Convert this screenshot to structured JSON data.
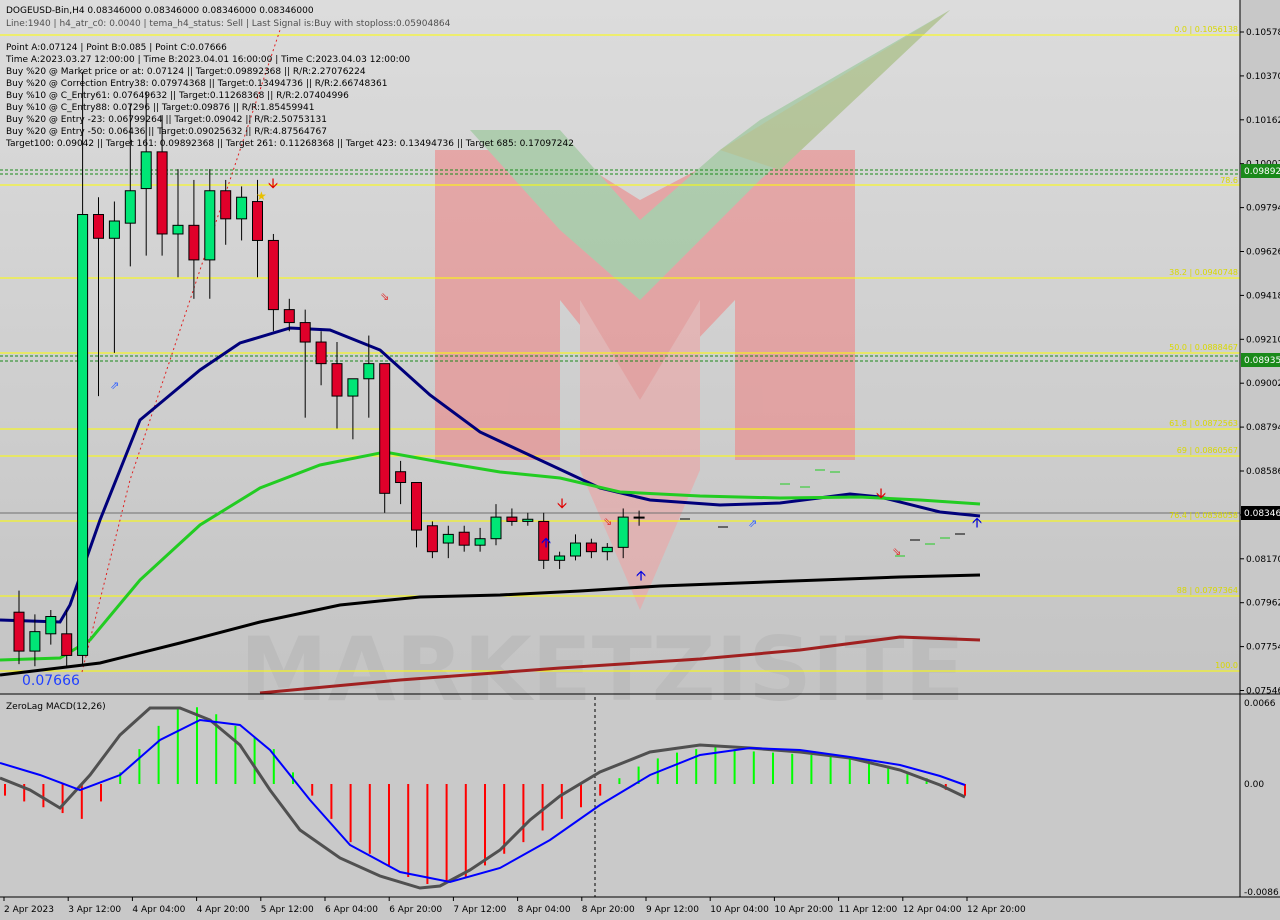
{
  "colors": {
    "background": "#c8c8c8",
    "bull_candle": "#00e676",
    "bear_candle": "#e0002a",
    "ma_navy": "#00007a",
    "ma_green": "#22cc22",
    "ma_black": "#000000",
    "ma_maroon": "#a02020",
    "fib_line": "#ffff00",
    "histogram_up": "#00ff00",
    "histogram_down": "#ff0000",
    "macd_line": "#505050",
    "signal_line": "#0000ff"
  },
  "header": {
    "symbol_line": "DOGEUSD-Bin,H4  0.08346000 0.08346000 0.08346000 0.08346000",
    "overlay_line": "Line:1940 | h4_atr_c0: 0.0040 | tema_h4_status: Sell | Last Signal is:Buy with stoploss:0.05904864",
    "lines": [
      "Point A:0.07124 | Point B:0.085 | Point C:0.07666",
      "Time A:2023.03.27 12:00:00 | Time B:2023.04.01 16:00:00 | Time C:2023.04.03 12:00:00",
      "Buy %20 @ Market price or at: 0.07124 || Target:0.09892368 || R/R:2.27076224",
      "Buy %20 @ Correction Entry38: 0.07974368 || Target:0.13494736 || R/R:2.66748361",
      "Buy %10 @ C_Entry61: 0.07649632 || Target:0.11268368 || R/R:2.07404996",
      "Buy %10 @ C_Entry88: 0.07296 || Target:0.09876 || R/R:1.85459941",
      "Buy %20 @ Entry -23: 0.06799264 || Target:0.09042 || R/R:2.50753131",
      "Buy %20 @ Entry -50: 0.06436 || Target:0.09025632 || R/R:4.87564767",
      "Target100: 0.09042 || Target 161: 0.09892368 || Target 261: 0.11268368 || Target 423: 0.13494736 || Target 685: 0.17097242"
    ]
  },
  "price_axis": {
    "ticks": [
      "0.10578",
      "0.10370",
      "0.10162",
      "0.10001",
      "0.09794",
      "0.09626",
      "0.09418",
      "0.09210",
      "0.09002",
      "0.08794",
      "0.08586",
      "0.08346",
      "0.08170",
      "0.07962",
      "0.07754",
      "0.07546"
    ],
    "current_price": "0.08346",
    "green_boxes": [
      "0.09892",
      "0.08935"
    ]
  },
  "fib_labels": [
    "0.0 | 0.1056138",
    "78.6",
    "38.2 | 0.0940748",
    "50.0 | 0.0888467",
    "61.8 | 0.0872563",
    "69 | 0.0860567",
    "76.4 | 0.0838058",
    "88 | 0.0797364",
    "100.0"
  ],
  "point_c_label": "0.07666",
  "watermark": "MARKETZISITE",
  "macd": {
    "title": "ZeroLag MACD(12,26)",
    "ticks": [
      "0.0066",
      "0.00",
      "-0.0086"
    ]
  },
  "time_axis": [
    "2 Apr 2023",
    "3 Apr 12:00",
    "4 Apr 04:00",
    "4 Apr 20:00",
    "5 Apr 12:00",
    "6 Apr 04:00",
    "6 Apr 20:00",
    "7 Apr 12:00",
    "8 Apr 04:00",
    "8 Apr 20:00",
    "9 Apr 12:00",
    "10 Apr 04:00",
    "10 Apr 20:00",
    "11 Apr 12:00",
    "12 Apr 04:00",
    "12 Apr 20:00"
  ],
  "chart_data": {
    "type": "candlestick",
    "title": "DOGEUSD-Bin,H4",
    "ylim": [
      0.0754,
      0.1064
    ],
    "candles": [
      {
        "o": 0.079,
        "h": 0.08,
        "l": 0.0766,
        "c": 0.0772
      },
      {
        "o": 0.0772,
        "h": 0.0789,
        "l": 0.0765,
        "c": 0.0781
      },
      {
        "o": 0.078,
        "h": 0.0791,
        "l": 0.0775,
        "c": 0.0788
      },
      {
        "o": 0.078,
        "h": 0.0791,
        "l": 0.0765,
        "c": 0.077
      },
      {
        "o": 0.077,
        "h": 0.104,
        "l": 0.0766,
        "c": 0.0974
      },
      {
        "o": 0.0974,
        "h": 0.0982,
        "l": 0.089,
        "c": 0.0963
      },
      {
        "o": 0.0963,
        "h": 0.098,
        "l": 0.091,
        "c": 0.0971
      },
      {
        "o": 0.097,
        "h": 0.1025,
        "l": 0.095,
        "c": 0.0985
      },
      {
        "o": 0.0986,
        "h": 0.1031,
        "l": 0.0955,
        "c": 0.1003
      },
      {
        "o": 0.1003,
        "h": 0.102,
        "l": 0.0955,
        "c": 0.0965
      },
      {
        "o": 0.0965,
        "h": 0.0995,
        "l": 0.0945,
        "c": 0.0969
      },
      {
        "o": 0.0969,
        "h": 0.099,
        "l": 0.0935,
        "c": 0.0953
      },
      {
        "o": 0.0953,
        "h": 0.0995,
        "l": 0.0935,
        "c": 0.0985
      },
      {
        "o": 0.0985,
        "h": 0.099,
        "l": 0.096,
        "c": 0.0972
      },
      {
        "o": 0.0972,
        "h": 0.0987,
        "l": 0.0962,
        "c": 0.0982
      },
      {
        "o": 0.098,
        "h": 0.099,
        "l": 0.0945,
        "c": 0.0962
      },
      {
        "o": 0.0962,
        "h": 0.0965,
        "l": 0.092,
        "c": 0.093
      },
      {
        "o": 0.093,
        "h": 0.0935,
        "l": 0.092,
        "c": 0.0924
      },
      {
        "o": 0.0924,
        "h": 0.093,
        "l": 0.088,
        "c": 0.0915
      },
      {
        "o": 0.0915,
        "h": 0.092,
        "l": 0.0895,
        "c": 0.0905
      },
      {
        "o": 0.0905,
        "h": 0.0915,
        "l": 0.0875,
        "c": 0.089
      },
      {
        "o": 0.089,
        "h": 0.0898,
        "l": 0.087,
        "c": 0.0898
      },
      {
        "o": 0.0898,
        "h": 0.0918,
        "l": 0.088,
        "c": 0.0905
      },
      {
        "o": 0.0905,
        "h": 0.0905,
        "l": 0.0836,
        "c": 0.0845
      },
      {
        "o": 0.0855,
        "h": 0.086,
        "l": 0.084,
        "c": 0.085
      },
      {
        "o": 0.085,
        "h": 0.085,
        "l": 0.082,
        "c": 0.0828
      },
      {
        "o": 0.083,
        "h": 0.0832,
        "l": 0.0815,
        "c": 0.0818
      },
      {
        "o": 0.0822,
        "h": 0.083,
        "l": 0.0815,
        "c": 0.0826
      },
      {
        "o": 0.0827,
        "h": 0.083,
        "l": 0.0818,
        "c": 0.0821
      },
      {
        "o": 0.0821,
        "h": 0.0829,
        "l": 0.0818,
        "c": 0.0824
      },
      {
        "o": 0.0824,
        "h": 0.084,
        "l": 0.0821,
        "c": 0.0834
      },
      {
        "o": 0.0834,
        "h": 0.0838,
        "l": 0.083,
        "c": 0.0832
      },
      {
        "o": 0.0832,
        "h": 0.0836,
        "l": 0.083,
        "c": 0.0833
      },
      {
        "o": 0.0832,
        "h": 0.0836,
        "l": 0.081,
        "c": 0.0814
      },
      {
        "o": 0.0814,
        "h": 0.0818,
        "l": 0.081,
        "c": 0.0816
      },
      {
        "o": 0.0816,
        "h": 0.0826,
        "l": 0.0814,
        "c": 0.0822
      },
      {
        "o": 0.0822,
        "h": 0.0824,
        "l": 0.0815,
        "c": 0.0818
      },
      {
        "o": 0.0818,
        "h": 0.0822,
        "l": 0.0814,
        "c": 0.082
      },
      {
        "o": 0.082,
        "h": 0.0838,
        "l": 0.0815,
        "c": 0.0834
      },
      {
        "o": 0.0834,
        "h": 0.0837,
        "l": 0.083,
        "c": 0.0834
      }
    ],
    "macd_histogram": [
      -0.001,
      -0.0015,
      -0.002,
      -0.0025,
      -0.003,
      -0.0015,
      0.001,
      0.003,
      0.005,
      0.0066,
      0.0066,
      0.006,
      0.005,
      0.004,
      0.003,
      0.001,
      -0.001,
      -0.003,
      -0.005,
      -0.006,
      -0.007,
      -0.008,
      -0.0086,
      -0.0085,
      -0.008,
      -0.007,
      -0.006,
      -0.005,
      -0.004,
      -0.003,
      -0.002,
      -0.001,
      0.0005,
      0.0015,
      0.0022,
      0.0027,
      0.003,
      0.0032,
      0.003,
      0.0028,
      0.0027,
      0.0026,
      0.0025,
      0.0024,
      0.0023,
      0.002,
      0.0015,
      0.001,
      0.0005,
      -0.0005,
      -0.001
    ]
  }
}
